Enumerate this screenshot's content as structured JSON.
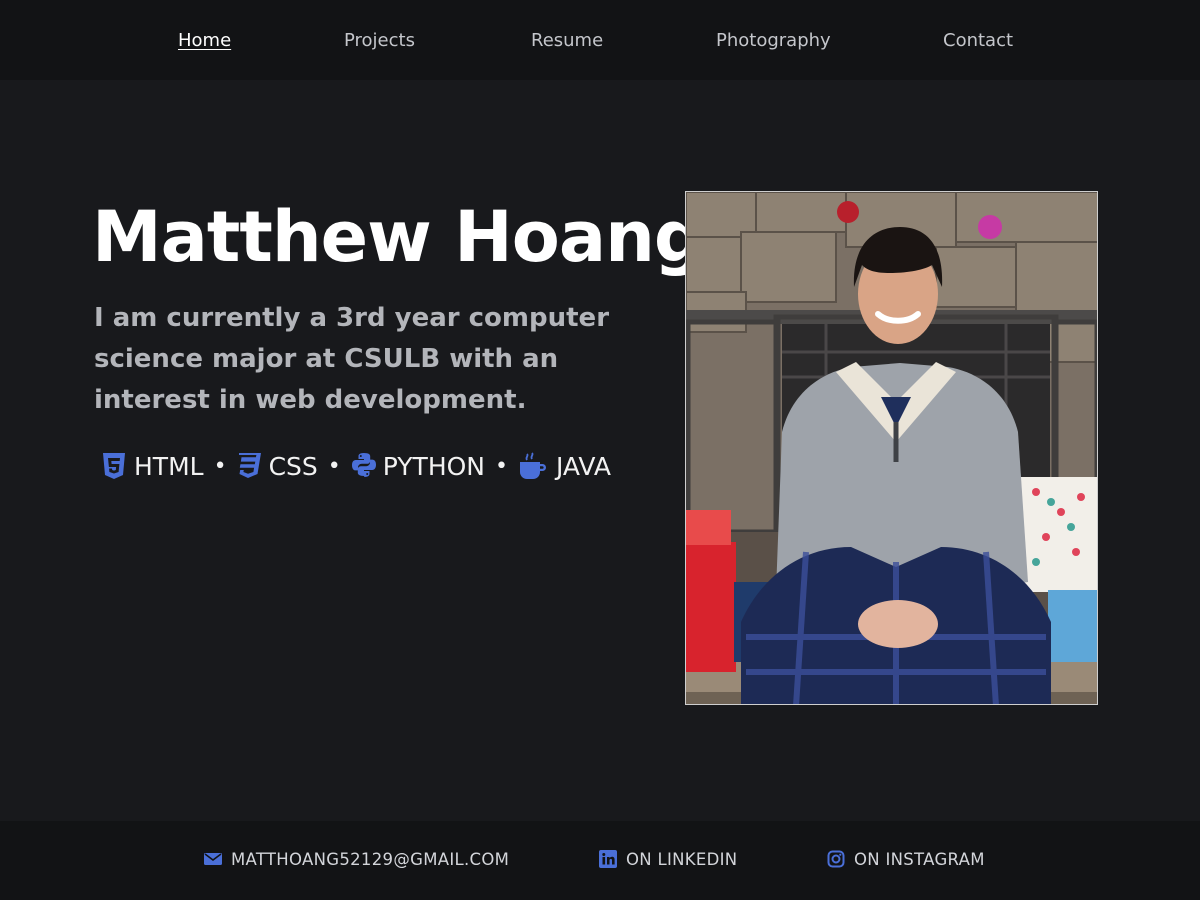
{
  "nav": {
    "items": [
      {
        "label": "Home",
        "active": true
      },
      {
        "label": "Projects",
        "active": false
      },
      {
        "label": "Resume",
        "active": false
      },
      {
        "label": "Photography",
        "active": false
      },
      {
        "label": "Contact",
        "active": false
      }
    ]
  },
  "hero": {
    "name": "Matthew Hoang",
    "bio": "I am currently a 3rd year computer science major at CSULB with an interest in web development."
  },
  "skills": {
    "separator": "•",
    "items": [
      {
        "label": "HTML",
        "icon": "html5-icon"
      },
      {
        "label": "CSS",
        "icon": "css3-icon"
      },
      {
        "label": "PYTHON",
        "icon": "python-icon"
      },
      {
        "label": "JAVA",
        "icon": "java-coffee-icon"
      }
    ]
  },
  "photo": {
    "subject": "portrait-photo"
  },
  "footer": {
    "email": {
      "label": "MATTHOANG52129@GMAIL.COM",
      "icon": "envelope-icon"
    },
    "linkedin": {
      "label": "ON LINKEDIN",
      "icon": "linkedin-icon"
    },
    "instagram": {
      "label": "ON INSTAGRAM",
      "icon": "instagram-icon"
    }
  },
  "colors": {
    "background": "#18191c",
    "bar": "#121315",
    "accent": "#4a6fd8",
    "text": "#ffffff",
    "muted": "#b3b5ba"
  }
}
